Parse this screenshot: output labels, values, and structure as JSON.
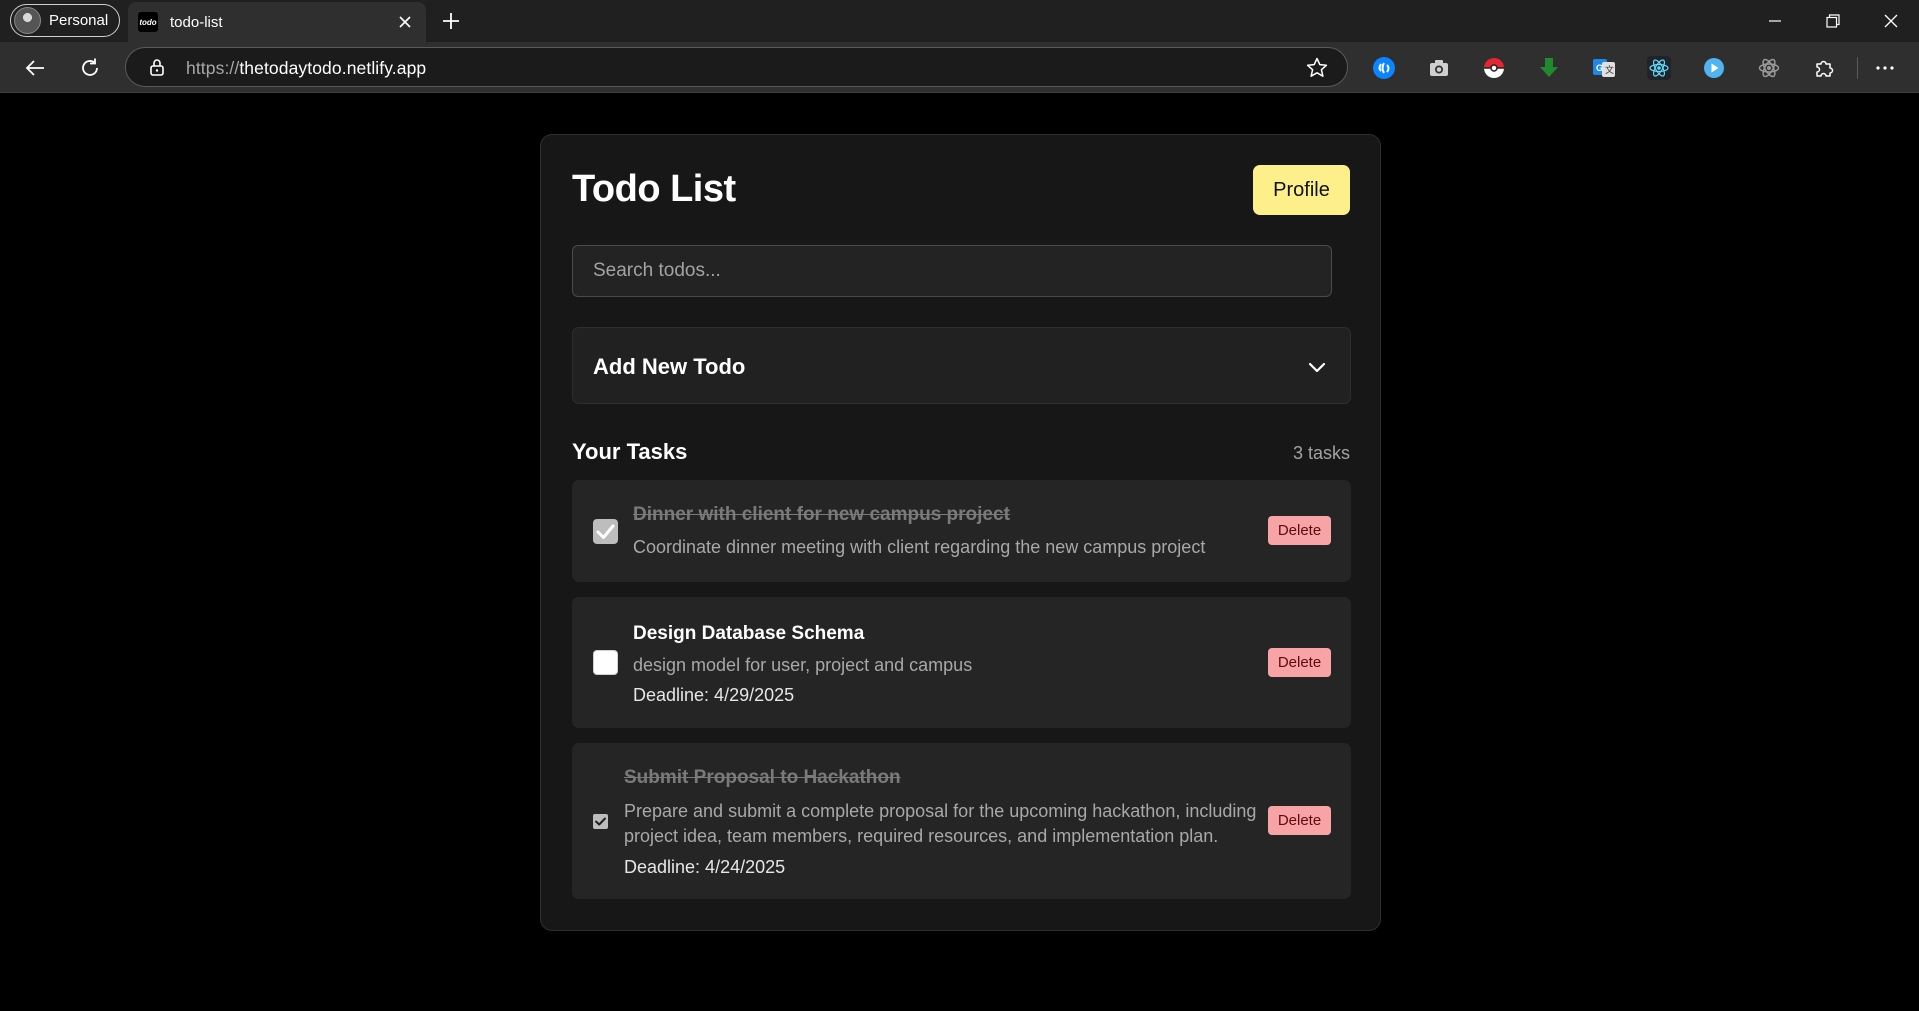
{
  "browser": {
    "profile_label": "Personal",
    "tab_title": "todo-list",
    "tab_favicon_text": "todo",
    "url_scheme": "https://",
    "url_host": "thetodaytodo.netlify.app",
    "extensions": [
      "shazam-icon",
      "camera-icon",
      "pokeball-icon",
      "download-arrow-icon",
      "translate-icon",
      "react-icon",
      "play-icon",
      "atom-icon",
      "puzzle-icon"
    ]
  },
  "page": {
    "title": "Todo List",
    "profile_button": "Profile",
    "search_placeholder": "Search todos...",
    "add_panel_title": "Add New Todo",
    "tasks_heading": "Your Tasks",
    "tasks_count": "3 tasks"
  },
  "tasks": [
    {
      "title": "Dinner with client for new campus project",
      "description": "Coordinate dinner meeting with client regarding the new campus project",
      "completed": true,
      "delete_label": "Delete"
    },
    {
      "title": "Design Database Schema",
      "description": "design model for user, project and campus",
      "deadline": "Deadline: 4/29/2025",
      "completed": false,
      "delete_label": "Delete"
    },
    {
      "title": "Submit Proposal to Hackathon",
      "description_line1": "Prepare and submit a complete proposal for the upcoming hackathon, including",
      "description_line2": "project idea, team members, required resources, and implementation plan.",
      "deadline": "Deadline: 4/24/2025",
      "completed": true,
      "delete_label": "Delete"
    }
  ],
  "colors": {
    "profile_button_bg": "#fdf08a",
    "delete_button_bg": "#f8a3a5",
    "card_bg": "#171717",
    "page_bg": "#000000"
  }
}
